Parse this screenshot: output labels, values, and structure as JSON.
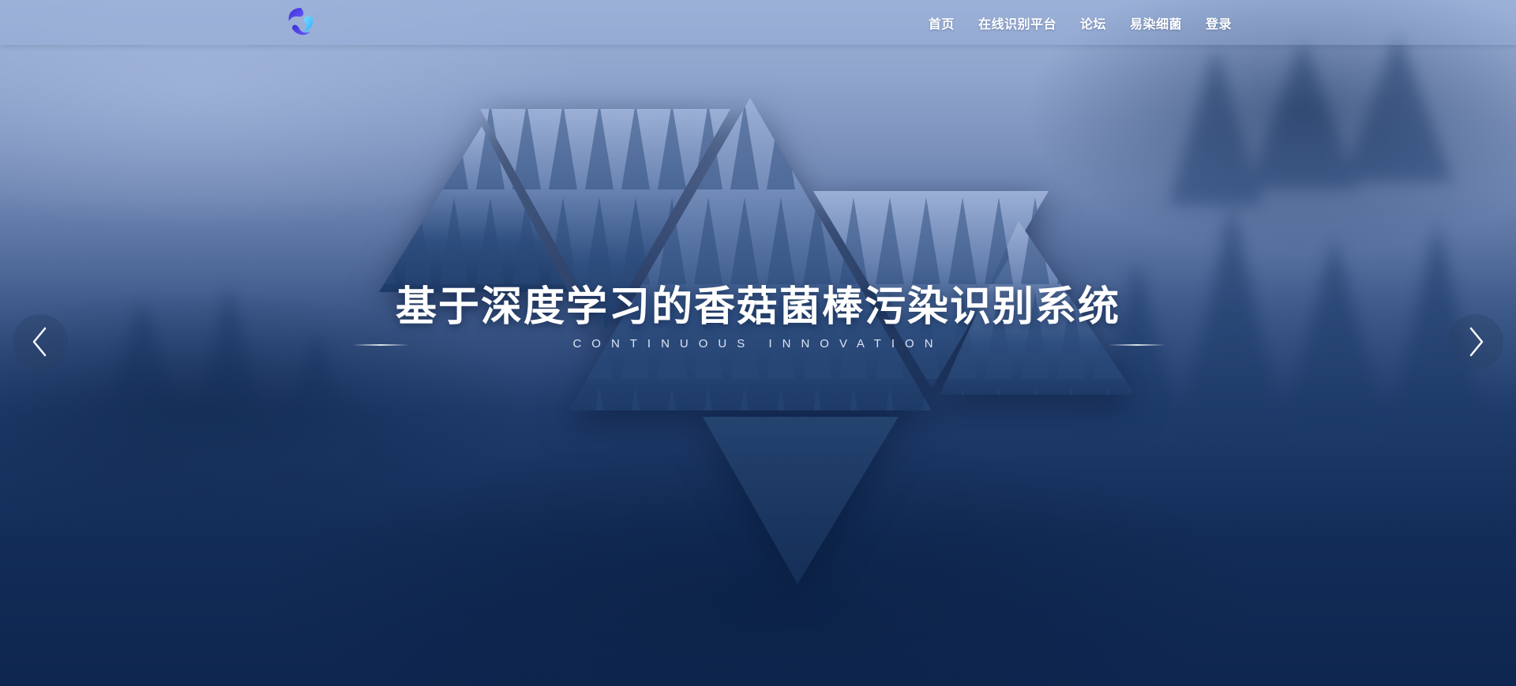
{
  "navbar": {
    "logo_icon": "swirl-logo-icon",
    "items": [
      {
        "label": "首页"
      },
      {
        "label": "在线识别平台"
      },
      {
        "label": "论坛"
      },
      {
        "label": "易染细菌"
      },
      {
        "label": "登录"
      }
    ]
  },
  "hero": {
    "title": "基于深度学习的香菇菌棒污染识别系统",
    "subtitle": "CONTINUOUS INNOVATION",
    "prev_icon": "chevron-left-icon",
    "next_icon": "chevron-right-icon"
  },
  "colors": {
    "sky_top": "#9fb3d8",
    "deep_blue": "#0e2650",
    "text": "#ffffff"
  }
}
